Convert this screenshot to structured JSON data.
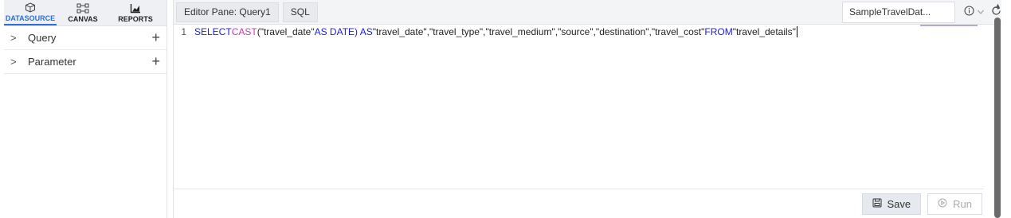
{
  "nav": {
    "tabs": [
      {
        "label": "DATASOURCE",
        "icon": "database-cube-icon",
        "active": true
      },
      {
        "label": "CANVAS",
        "icon": "canvas-nodes-icon",
        "active": false
      },
      {
        "label": "REPORTS",
        "icon": "bar-chart-icon",
        "active": false
      }
    ]
  },
  "tree": {
    "items": [
      {
        "label": "Query",
        "chevron": ">",
        "add": "+"
      },
      {
        "label": "Parameter",
        "chevron": ">",
        "add": "+"
      }
    ]
  },
  "editor": {
    "tabs": [
      {
        "label": "Editor Pane: Query1"
      },
      {
        "label": "SQL"
      }
    ],
    "datasource": "SampleTravelDat...",
    "line_number": "1",
    "sql": {
      "kw1": "SELECT ",
      "fn": "CAST",
      "s1": "(\"travel_date\" ",
      "kw2": "AS DATE) AS ",
      "s2": "\"travel_date\",\"travel_type\",\"travel_medium\",\"source\",\"destination\",\"travel_cost\" ",
      "kw3": "FROM ",
      "s3": "\"travel_details\""
    }
  },
  "footer": {
    "save_label": "Save",
    "run_label": "Run"
  },
  "colors": {
    "accent": "#2d6fd8",
    "keyword": "#1c1ce0",
    "function": "#c23cb0"
  }
}
